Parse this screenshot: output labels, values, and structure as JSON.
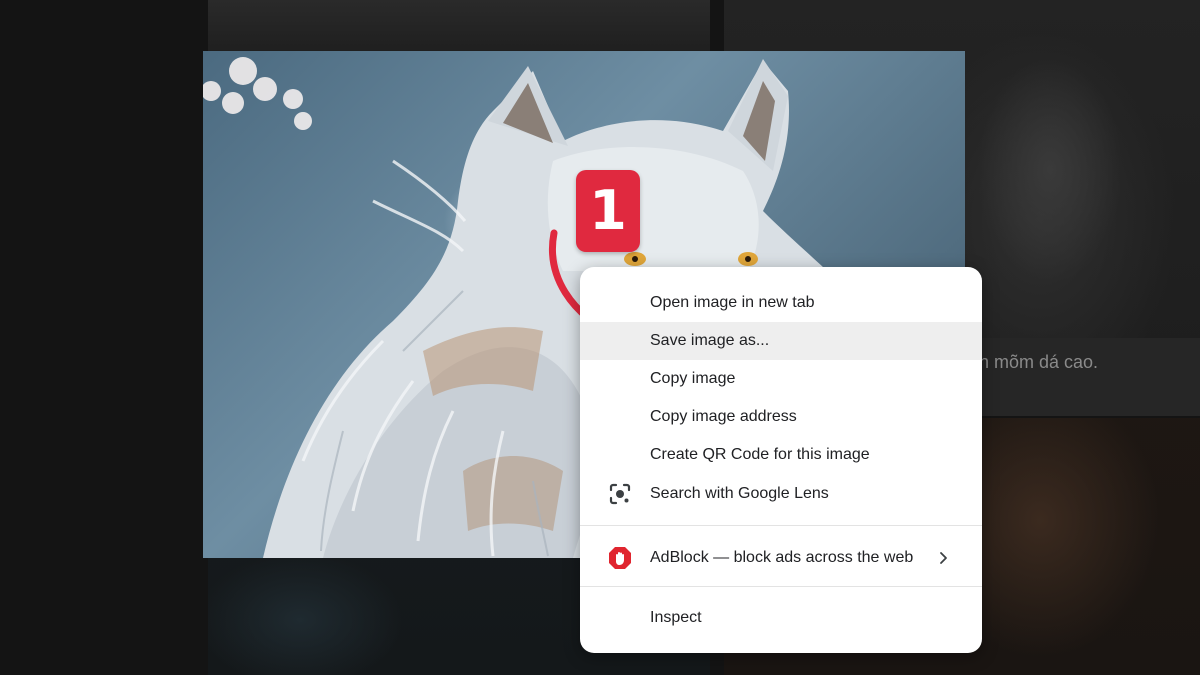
{
  "background": {
    "caption_text": "n mõm dá cao."
  },
  "step_badge": {
    "number": "1",
    "color": "#e0293f"
  },
  "context_menu": {
    "items": [
      {
        "label": "Open image in new tab",
        "icon": ""
      },
      {
        "label": "Save image as...",
        "icon": "",
        "highlighted": true
      },
      {
        "label": "Copy image",
        "icon": ""
      },
      {
        "label": "Copy image address",
        "icon": ""
      },
      {
        "label": "Create QR Code for this image",
        "icon": ""
      },
      {
        "label": "Search with Google Lens",
        "icon": "google-lens-icon"
      }
    ],
    "extension_item": {
      "label": "AdBlock — block ads across the web",
      "icon": "adblock-icon",
      "submenu_icon": "chevron-right-icon"
    },
    "inspect_item": {
      "label": "Inspect"
    }
  }
}
